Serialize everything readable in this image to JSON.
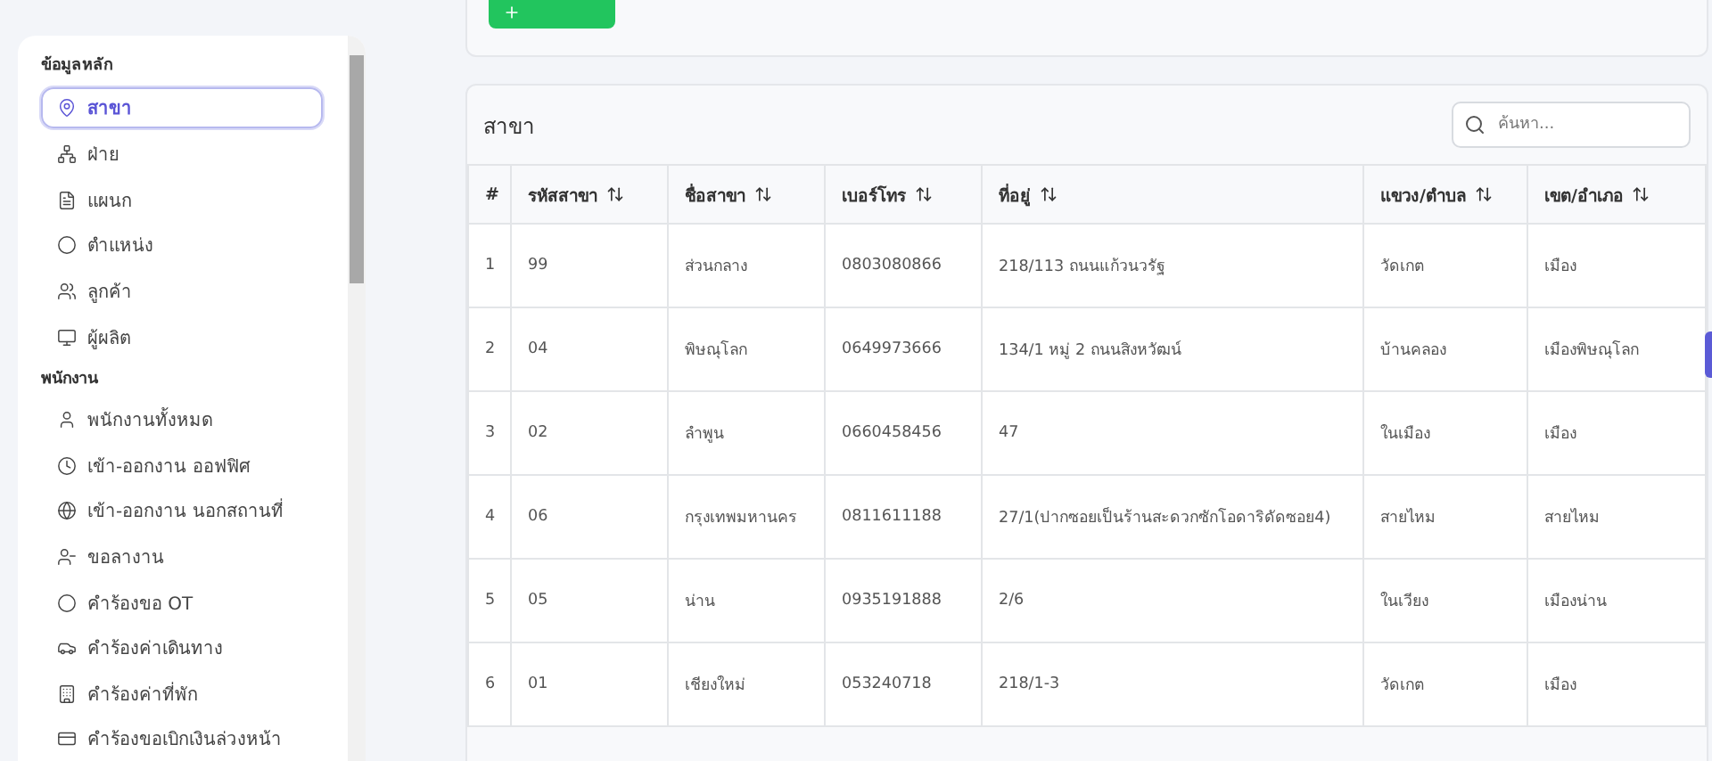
{
  "sidebar": {
    "sections": [
      {
        "title": "ข้อมูลหลัก",
        "items": [
          {
            "label": "สาขา",
            "selected": true
          },
          {
            "label": "ฝ่าย",
            "selected": false
          },
          {
            "label": "แผนก",
            "selected": false
          },
          {
            "label": "ตำแหน่ง",
            "selected": false
          },
          {
            "label": "ลูกค้า",
            "selected": false
          },
          {
            "label": "ผู้ผลิต",
            "selected": false
          }
        ]
      },
      {
        "title": "พนักงาน",
        "items": [
          {
            "label": "พนักงานทั้งหมด",
            "selected": false
          },
          {
            "label": "เข้า-ออกงาน ออฟฟิศ",
            "selected": false
          },
          {
            "label": "เข้า-ออกงาน นอกสถานที่",
            "selected": false
          },
          {
            "label": "ขอลางาน",
            "selected": false
          },
          {
            "label": "คำร้องขอ OT",
            "selected": false
          },
          {
            "label": "คำร้องค่าเดินทาง",
            "selected": false
          },
          {
            "label": "คำร้องค่าที่พัก",
            "selected": false
          },
          {
            "label": "คำร้องขอเบิกเงินล่วงหน้า",
            "selected": false
          }
        ]
      }
    ]
  },
  "table": {
    "title": "สาขา",
    "search": {
      "placeholder": "ค้นหา..."
    },
    "columns": [
      {
        "label": "#",
        "sortable": false
      },
      {
        "label": "รหัสสาขา",
        "sortable": true
      },
      {
        "label": "ชื่อสาขา",
        "sortable": true
      },
      {
        "label": "เบอร์โทร",
        "sortable": true
      },
      {
        "label": "ที่อยู่",
        "sortable": true
      },
      {
        "label": "แขวง/ตำบล",
        "sortable": true
      },
      {
        "label": "เขต/อำเภอ",
        "sortable": true
      }
    ],
    "rows": [
      [
        "1",
        "99",
        "ส่วนกลาง",
        "0803080866",
        "218/113 ถนนแก้วนวรัฐ",
        "วัดเกต",
        "เมือง"
      ],
      [
        "2",
        "04",
        "พิษณุโลก",
        "0649973666",
        "134/1 หมู่ 2 ถนนสิงหวัฒน์",
        "บ้านคลอง",
        "เมืองพิษณุโลก"
      ],
      [
        "3",
        "02",
        "ลำพูน",
        "0660458456",
        "47",
        "ในเมือง",
        "เมือง"
      ],
      [
        "4",
        "06",
        "กรุงเทพมหานคร",
        "0811611188",
        "27/1(ปากซอยเป็นร้านสะดวกซักโอดาริดัดซอย4)",
        "สายไหม",
        "สายไหม"
      ],
      [
        "5",
        "05",
        "น่าน",
        "0935191888",
        "2/6",
        "ในเวียง",
        "เมืองน่าน"
      ],
      [
        "6",
        "01",
        "เชียงใหม่",
        "053240718",
        "218/1-3",
        "วัดเกต",
        "เมือง"
      ]
    ]
  }
}
